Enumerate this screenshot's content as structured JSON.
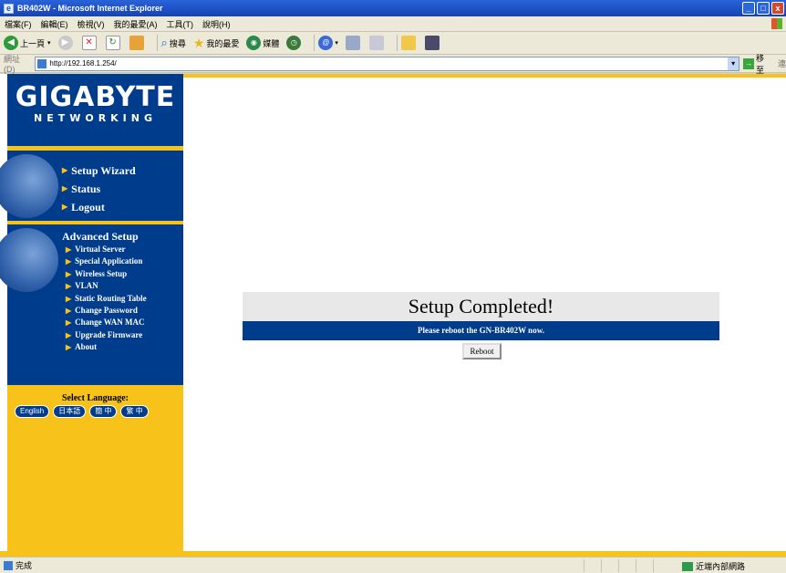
{
  "window": {
    "title": "BR402W - Microsoft Internet Explorer",
    "buttons": [
      "_",
      "□",
      "x"
    ]
  },
  "menubar": {
    "items": [
      "檔案(F)",
      "編輯(E)",
      "檢視(V)",
      "我的最愛(A)",
      "工具(T)",
      "說明(H)"
    ]
  },
  "toolbar": {
    "back": "上一頁",
    "search": "搜尋",
    "favorites": "我的最愛",
    "media": "媒體"
  },
  "address": {
    "label": "網址(D)",
    "url": "http://192.168.1.254/",
    "go": "移至",
    "links": "連"
  },
  "brand": {
    "name": "GIGABYTE",
    "sub": "NETWORKING"
  },
  "nav_main": {
    "items": [
      "Setup Wizard",
      "Status",
      "Logout"
    ]
  },
  "nav_advanced": {
    "title": "Advanced Setup",
    "items": [
      "Virtual Server",
      "Special Application",
      "Wireless Setup",
      "VLAN",
      "Static Routing Table",
      "Change Password",
      "Change WAN MAC",
      "Upgrade Firmware",
      "About"
    ]
  },
  "language": {
    "title": "Select Language:",
    "options": [
      "English",
      "日本語",
      "簡 中",
      "繁 中"
    ]
  },
  "main": {
    "heading": "Setup Completed!",
    "message": "Please reboot the GN-BR402W now.",
    "reboot_label": "Reboot"
  },
  "status": {
    "left": "完成",
    "zone": "近端內部網路"
  }
}
